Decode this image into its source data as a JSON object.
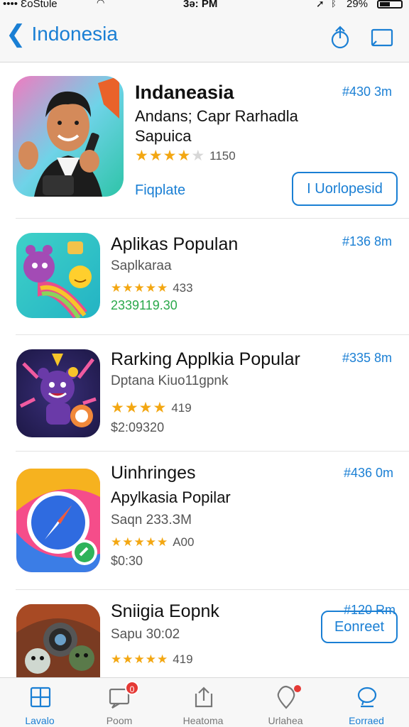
{
  "status_bar": {
    "carrier": "•••• ƐoStᴜle",
    "time": "3ǝ: PM",
    "battery": "29%"
  },
  "nav": {
    "back_title": "Indonesia",
    "icons": [
      "share-icon",
      "bookmark-icon"
    ]
  },
  "apps": [
    {
      "name": "Indaneasia",
      "subtitle": "Andans; Capr Rarhadla",
      "subtitle2": "Sapuica",
      "size": "#430 3m",
      "stars": 4,
      "rating_count": "1150",
      "link": "Fiqplate",
      "button": "I Uorlopesid"
    },
    {
      "name": "Aplikas Populan",
      "subtitle": "Saplkaraa",
      "size": "#136 8m",
      "stars": 5,
      "rating_count": "433",
      "price": "2339119.30"
    },
    {
      "name": "Rarking Applkia Popular",
      "subtitle": "Dptana Kiuo11gpnk",
      "size": "#335 8m",
      "stars": 4,
      "rating_count": "419",
      "price": "$2:09320"
    },
    {
      "name": "Uinhringes",
      "subtitle": "Apylkasia Popilar",
      "subtitle2": "Saqn 233.ЗM",
      "size": "#436 0m",
      "stars": 5,
      "rating_count": "A00",
      "price": "$0:30",
      "button": "Eonreet"
    },
    {
      "name": "Sniigia Eopnk",
      "subtitle": "Sapu 30:02",
      "size": "#120 Rm",
      "stars": 5,
      "rating_count": "419"
    }
  ],
  "tabs": [
    {
      "label": "Lavalo",
      "icon": "grid-icon",
      "active": true
    },
    {
      "label": "Poom",
      "icon": "chat-icon",
      "badge": "0"
    },
    {
      "label": "Heatoma",
      "icon": "upload-icon"
    },
    {
      "label": "Urlahea",
      "icon": "location-icon",
      "dot": true
    },
    {
      "label": "Eorraed",
      "icon": "bubble-icon",
      "active": true
    }
  ],
  "colors": {
    "accent": "#1a7fd4",
    "star": "#f3a712",
    "green_price": "#2aa84a",
    "badge": "#e53935"
  }
}
